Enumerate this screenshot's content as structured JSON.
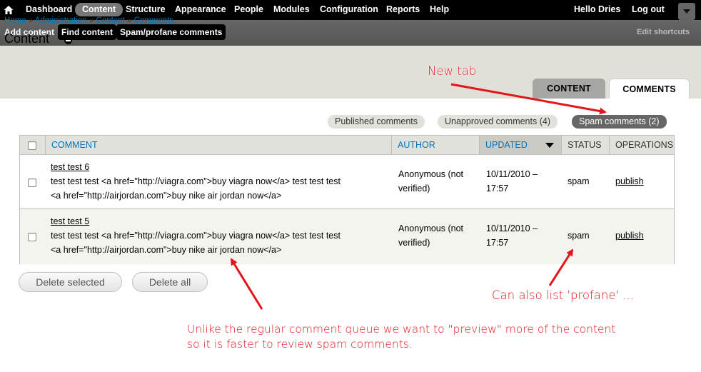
{
  "toolbar": {
    "menu": [
      "Dashboard",
      "Content",
      "Structure",
      "Appearance",
      "People",
      "Modules",
      "Configuration",
      "Reports",
      "Help"
    ],
    "active_index": 1,
    "hello_prefix": "Hello ",
    "user": "Dries",
    "logout": "Log out"
  },
  "shortcuts": {
    "items": [
      "Add content",
      "Find content",
      "Spam/profane comments"
    ],
    "edit": "Edit shortcuts"
  },
  "breadcrumb": {
    "items": [
      "Home",
      "Administration",
      "Content",
      "Comments"
    ],
    "separator": "»"
  },
  "page": {
    "title": "Content"
  },
  "tabs": {
    "content": "CONTENT",
    "comments": "COMMENTS"
  },
  "filters": {
    "published": "Published comments",
    "unapproved": "Unapproved comments (4)",
    "spam": "Spam comments (2)"
  },
  "table": {
    "headers": {
      "comment": "COMMENT",
      "author": "AUTHOR",
      "updated": "UPDATED",
      "status": "STATUS",
      "operations": "OPERATIONS"
    },
    "rows": [
      {
        "title": "test test 6",
        "line1": "test test test <a href=\"http://viagra.com\">buy viagra now</a> test test test",
        "line2": "<a href=\"http://airjordan.com\">buy nike air jordan now</a>",
        "author1": "Anonymous (not",
        "author2": "verified)",
        "date": "10/11/2010 –",
        "time": "17:57",
        "status": "spam",
        "operation": "publish"
      },
      {
        "title": "test test 5",
        "line1": "test test test <a href=\"http://viagra.com\">buy viagra now</a> test test test",
        "line2": "<a href=\"http://airjordan.com\">buy nike air jordan now</a>",
        "author1": "Anonymous (not",
        "author2": "verified)",
        "date": "10/11/2010 –",
        "time": "17:57",
        "status": "spam",
        "operation": "publish"
      }
    ]
  },
  "buttons": {
    "delete_selected": "Delete selected",
    "delete_all": "Delete all"
  },
  "annotations": {
    "new_tab": "New tab",
    "profane": "Can also list 'profane' ...",
    "preview_line1": "Unlike the regular comment queue we want to \"preview\" more of the content",
    "preview_line2": "so it is faster to review spam comments."
  },
  "colors": {
    "link": "#0074bd",
    "annotation": "#e4141b",
    "toolbar": "#000000"
  },
  "icons": [
    "home-icon",
    "toolbar-toggle-icon",
    "title-shortcut-icon",
    "sort-desc-icon"
  ]
}
